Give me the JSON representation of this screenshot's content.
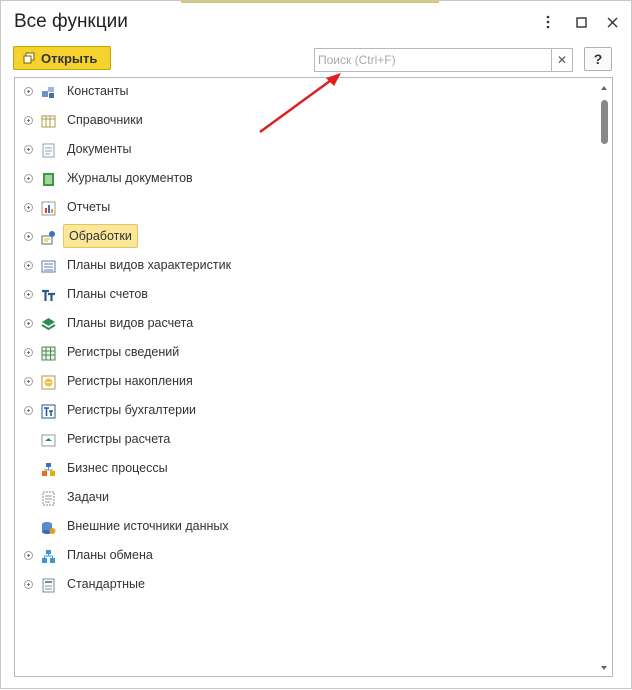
{
  "window": {
    "title": "Все функции",
    "menu_icon": "more-vertical-icon",
    "maximize_icon": "maximize-icon",
    "close_icon": "close-icon"
  },
  "toolbar": {
    "open_label": "Открыть",
    "search_placeholder": "Поиск (Ctrl+F)",
    "search_value": "",
    "help_label": "?"
  },
  "tree": {
    "items": [
      {
        "label": "Константы",
        "icon": "constants-icon",
        "expandable": true,
        "selected": false
      },
      {
        "label": "Справочники",
        "icon": "catalogs-icon",
        "expandable": true,
        "selected": false
      },
      {
        "label": "Документы",
        "icon": "documents-icon",
        "expandable": true,
        "selected": false
      },
      {
        "label": "Журналы документов",
        "icon": "document-journals-icon",
        "expandable": true,
        "selected": false
      },
      {
        "label": "Отчеты",
        "icon": "reports-icon",
        "expandable": true,
        "selected": false
      },
      {
        "label": "Обработки",
        "icon": "data-processors-icon",
        "expandable": true,
        "selected": true
      },
      {
        "label": "Планы видов характеристик",
        "icon": "characteristic-types-icon",
        "expandable": true,
        "selected": false
      },
      {
        "label": "Планы счетов",
        "icon": "charts-of-accounts-icon",
        "expandable": true,
        "selected": false
      },
      {
        "label": "Планы видов расчета",
        "icon": "calculation-types-icon",
        "expandable": true,
        "selected": false
      },
      {
        "label": "Регистры сведений",
        "icon": "information-registers-icon",
        "expandable": true,
        "selected": false
      },
      {
        "label": "Регистры накопления",
        "icon": "accumulation-registers-icon",
        "expandable": true,
        "selected": false
      },
      {
        "label": "Регистры бухгалтерии",
        "icon": "accounting-registers-icon",
        "expandable": true,
        "selected": false
      },
      {
        "label": "Регистры расчета",
        "icon": "calculation-registers-icon",
        "expandable": false,
        "selected": false
      },
      {
        "label": "Бизнес процессы",
        "icon": "business-processes-icon",
        "expandable": false,
        "selected": false
      },
      {
        "label": "Задачи",
        "icon": "tasks-icon",
        "expandable": false,
        "selected": false
      },
      {
        "label": "Внешние источники данных",
        "icon": "external-data-sources-icon",
        "expandable": false,
        "selected": false
      },
      {
        "label": "Планы обмена",
        "icon": "exchange-plans-icon",
        "expandable": true,
        "selected": false
      },
      {
        "label": "Стандартные",
        "icon": "standard-icon",
        "expandable": true,
        "selected": false
      }
    ]
  },
  "colors": {
    "open_button": "#f5d22e",
    "selection": "#fbe79a",
    "annotation_arrow": "#e02020"
  }
}
